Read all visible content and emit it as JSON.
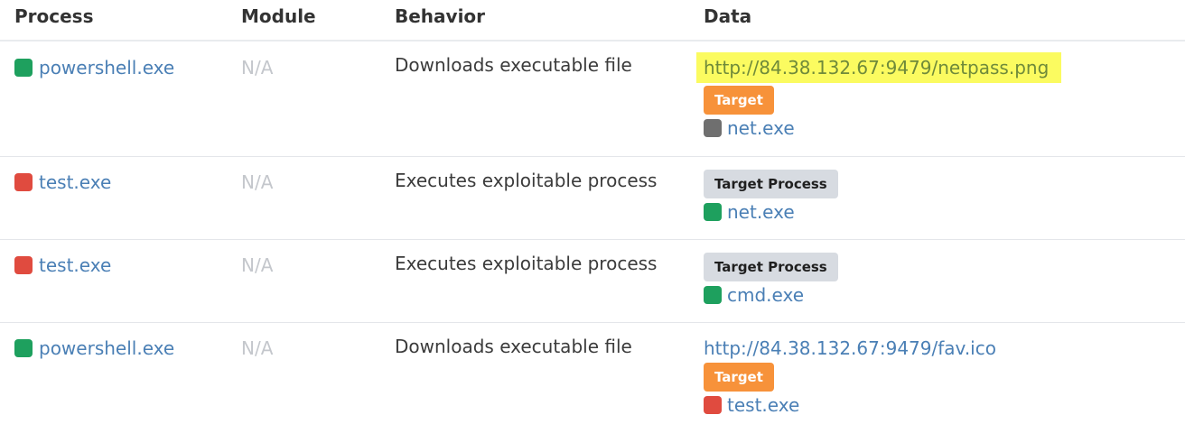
{
  "columns": {
    "process": "Process",
    "module": "Module",
    "behavior": "Behavior",
    "data": "Data"
  },
  "colors": {
    "green": "#1ea05e",
    "red": "#e04b3f",
    "gray": "#6f6f6f",
    "link": "#4a7fb5",
    "highlight": "#fbfb60",
    "orange_badge": "#f7923a",
    "gray_badge": "#d7dbe1"
  },
  "rows": [
    {
      "process": "powershell.exe",
      "process_color": "#1ea05e",
      "module": "N/A",
      "behavior": "Downloads executable file",
      "data_url": "http://84.38.132.67:9479/netpass.png",
      "url_highlighted": true,
      "badge": "Target",
      "badge_style": "orange",
      "target": "net.exe",
      "target_color": "#6f6f6f"
    },
    {
      "process": "test.exe",
      "process_color": "#e04b3f",
      "module": "N/A",
      "behavior": "Executes exploitable process",
      "badge": "Target Process",
      "badge_style": "gray",
      "target": "net.exe",
      "target_color": "#1ea05e"
    },
    {
      "process": "test.exe",
      "process_color": "#e04b3f",
      "module": "N/A",
      "behavior": "Executes exploitable process",
      "badge": "Target Process",
      "badge_style": "gray",
      "target": "cmd.exe",
      "target_color": "#1ea05e"
    },
    {
      "process": "powershell.exe",
      "process_color": "#1ea05e",
      "module": "N/A",
      "behavior": "Downloads executable file",
      "data_url": "http://84.38.132.67:9479/fav.ico",
      "url_highlighted": false,
      "badge": "Target",
      "badge_style": "orange",
      "target": "test.exe",
      "target_color": "#e04b3f"
    }
  ]
}
